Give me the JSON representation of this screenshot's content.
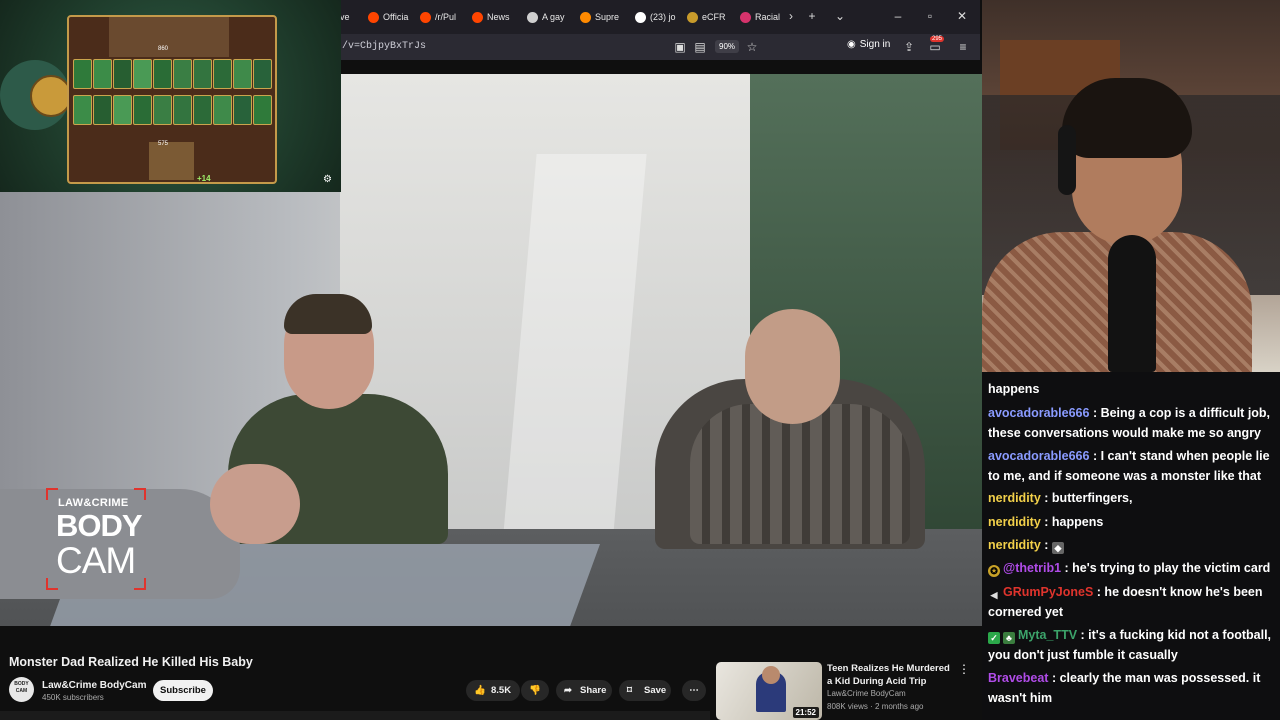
{
  "browser": {
    "tabs": [
      {
        "label": "ve",
        "color": "#1f1e25"
      },
      {
        "label": "Officia",
        "color": "#ff4500"
      },
      {
        "label": "/r/Pul",
        "color": "#ff4500"
      },
      {
        "label": "News",
        "color": "#ff4500"
      },
      {
        "label": "A gay",
        "color": "#cfcfcf"
      },
      {
        "label": "Supre",
        "color": "#ff8a00"
      },
      {
        "label": "(23) jo",
        "color": "#ffffff"
      },
      {
        "label": "eCFR",
        "color": "#c89b2b"
      },
      {
        "label": "Racial",
        "color": "#d6336c"
      }
    ],
    "url": "/v=CbjpyBxTrJs",
    "zoom": "90%",
    "sign_in": "Sign in",
    "notification_count": "295"
  },
  "video": {
    "logo_top": "LAW&CRIME",
    "logo_line1": "BODY",
    "logo_line2": "CAM"
  },
  "game": {
    "top_count": "860",
    "bottom_count": "575",
    "bonus": "+14"
  },
  "chat": {
    "messages": [
      {
        "user": "",
        "color": "#ffffff",
        "text": "happens"
      },
      {
        "user": "avocadorable666",
        "color": "#8a9bff",
        "text": ": Being a cop is a difficult job, these conversations would make me so angry"
      },
      {
        "user": "avocadorable666",
        "color": "#8a9bff",
        "text": ": I can't stand when people lie to me, and if someone was a monster like that"
      },
      {
        "user": "nerdidity",
        "color": "#f2d04a",
        "text": ": butterfingers,"
      },
      {
        "user": "nerdidity",
        "color": "#f2d04a",
        "text": ": happens"
      },
      {
        "user": "nerdidity",
        "color": "#f2d04a",
        "text": ":"
      },
      {
        "user": "@thetrib1",
        "color": "#b04ce8",
        "text": ": he's trying to play the victim card"
      },
      {
        "user": "GRumPyJoneS",
        "color": "#e0342d",
        "text": ": he doesn't know he's been cornered yet"
      },
      {
        "user": "Myta_TTV",
        "color": "#3ca36a",
        "text": ": it's a fucking kid not a football, you don't just fumble it casually"
      },
      {
        "user": "Bravebeat",
        "color": "#b04ce8",
        "text": ": clearly the man was possessed. it wasn't him"
      }
    ]
  },
  "youtube": {
    "title": "Monster Dad Realized He Killed His Baby",
    "channel": "Law&Crime BodyCam",
    "subscribers": "450K subscribers",
    "subscribe": "Subscribe",
    "likes": "8.5K",
    "share": "Share",
    "save": "Save",
    "avatar_text": "BODY CAM",
    "recommended": {
      "title": "Teen Realizes He Murdered a Kid During Acid Trip",
      "channel": "Law&Crime BodyCam",
      "meta": "808K views · 2 months ago",
      "duration": "21:52"
    }
  }
}
